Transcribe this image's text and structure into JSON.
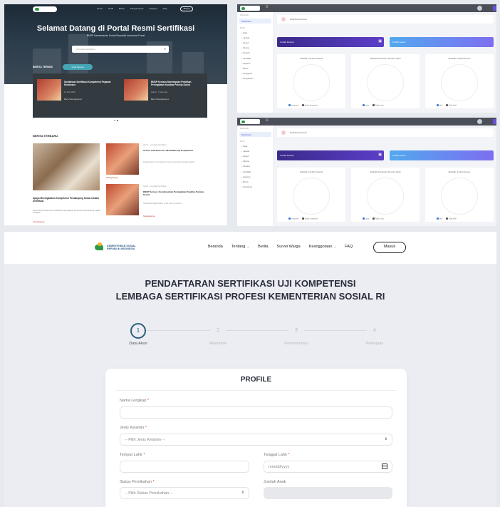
{
  "portal": {
    "menu": [
      "Home",
      "Profil",
      "Berita",
      "Pengumuman",
      "Kategori",
      "FAQ"
    ],
    "login_label": "Masuk",
    "title": "Selamat Datang di Portal Resmi Sertifikasi",
    "subtitle": "BNSP Kementerian Sosial Republik Indonesia Pusat",
    "search_placeholder": "Cari Data Sertifikasi...",
    "band_label": "BERITA TERKINI",
    "band_pill": "Lihat Semua",
    "news": [
      {
        "title": "Sosialisasi Sertifikasi Kompetensi Pegawai Kemensos",
        "meta": "12 Mei 2023",
        "link": "Baca Selengkapnya"
      },
      {
        "title": "BNSP Kemsos Menetapkan Pelatihan Peningkatan Kualitas Pekerja Sosial",
        "meta": "Admin · 5 Jam lalu",
        "link": "Baca Selengkapnya"
      }
    ],
    "berita_heading": "BERITA TERBARU",
    "berita_big": {
      "title": "Upaya Meningkatkan Kompetensi Pendamping Sosial melalui Sertifikasi",
      "desc": "Kementerian Sosial terus melakukan peningkatan kompetensi pendamping melalui sertifikasi.",
      "link": "Selengkapnya"
    },
    "berita_items": [
      {
        "meta": "Admin · Lembaga Sertifikasi",
        "title": "Asesor LSP Kemsos Laksanakan Uji Kompetensi",
        "desc": "Pelaksanaan uji kompetensi bagi peserta dari berbagai daerah.",
        "link": "Selengkapnya"
      },
      {
        "meta": "Admin · Lembaga Sertifikasi",
        "title": "BNSP Kemsos Sosialisasikan Peningkatan Kualitas Pekerja Sosial",
        "desc": "Sosialisasi dilaksanakan untuk seluruh peserta.",
        "link": "Selengkapnya"
      }
    ]
  },
  "dashboard": {
    "crumb": "Dashboard Admin",
    "side_caption": "NAVIGASI",
    "side_active": "Dashboard",
    "side_caption2": "DATA",
    "side_items": [
      "Data",
      "Jadwal",
      "Asesor",
      "Skema",
      "Peserta",
      "Sertifikat",
      "Laporan",
      "Berita",
      "Pengguna",
      "Pengaturan"
    ],
    "banner_left": "Jumlah Peserta",
    "banner_right": "Jumlah Asesor",
    "cards": [
      {
        "title": "Statistik Jumlah Peserta",
        "legend": [
          "Kompeten",
          "Belum Kompeten"
        ]
      },
      {
        "title": "Statistik Kelulusan Peserta Ujian",
        "legend": [
          "Lulus",
          "Tidak Lulus"
        ]
      },
      {
        "title": "Statistik Jumlah Asesor",
        "legend": [
          "Aktif",
          "Tidak Aktif"
        ]
      }
    ],
    "colors": {
      "banner_left": "#5b3ec8",
      "banner_right": "#52a9ef"
    }
  },
  "form": {
    "logo_line1": "KEMENTERIAN SOSIAL",
    "logo_line2": "REPUBLIK INDONESIA",
    "menu": {
      "beranda": "Beranda",
      "tentang": "Tentang",
      "berita": "Berita",
      "survei": "Survei Warga",
      "keanggotaan": "Keanggotaan",
      "faq": "FAQ"
    },
    "login_label": "Masuk",
    "heading_line1": "PENDAFTARAN SERTIFIKASI UJI KOMPETENSI",
    "heading_line2": "LEMBAGA SERTIFIKASI PROFESI KEMENTERIAN SOSIAL RI",
    "steps": [
      {
        "num": "1",
        "label": "Data Akun"
      },
      {
        "num": "2",
        "label": "Akademik"
      },
      {
        "num": "3",
        "label": "Rekomendasi"
      },
      {
        "num": "4",
        "label": "Pekerjaan"
      }
    ],
    "card_title": "PROFILE",
    "fields": {
      "nama": {
        "label": "Nama Lengkap",
        "required": "*",
        "value": ""
      },
      "jenis_kelamin": {
        "label": "Jenis Kelamin",
        "required": "*",
        "value": "-- Pilih Jenis Kelamin --"
      },
      "tempat_lahir": {
        "label": "Tempat Lahir",
        "required": "*",
        "value": ""
      },
      "tanggal_lahir": {
        "label": "Tanggal Lahir",
        "required": "*",
        "value": "mm/dd/yyyy"
      },
      "status_pernikahan": {
        "label": "Status Pernikahan",
        "required": "*",
        "value": "-- Pilih Status Pernikahan --"
      },
      "jumlah_anak": {
        "label": "Jumlah Anak",
        "value": ""
      }
    },
    "colors": {
      "step_active": "#2a5d7a",
      "required": "#d9363e"
    }
  }
}
